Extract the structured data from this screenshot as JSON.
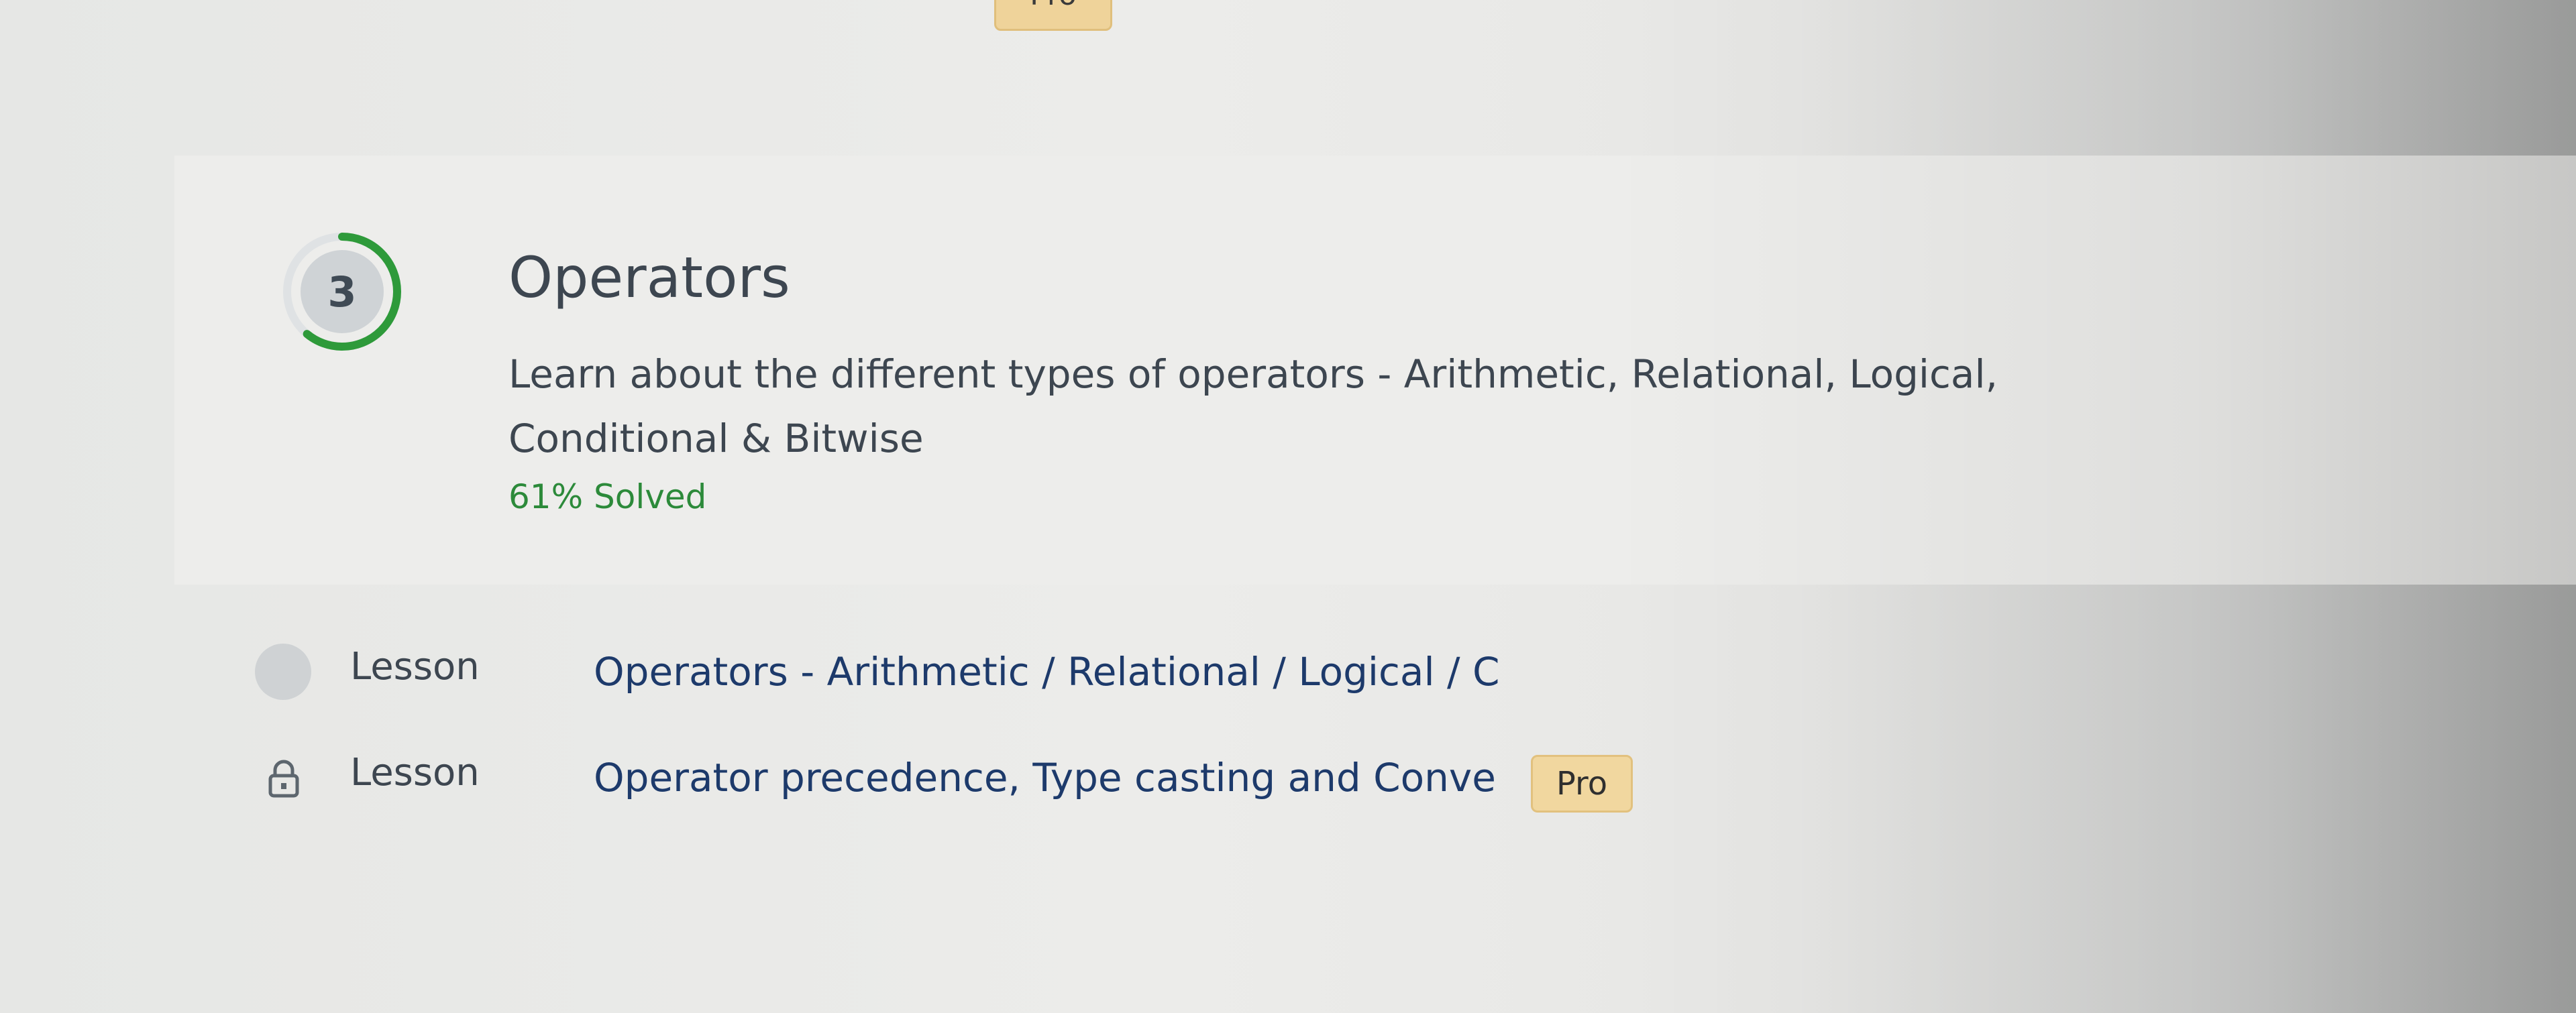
{
  "previous_module": {
    "badge_label": "Pro"
  },
  "module": {
    "number": "3",
    "title": "Operators",
    "description": "Learn about the different types of operators - Arithmetic, Relational, Logical, Conditional & Bitwise",
    "progress_label": "61% Solved",
    "progress_fraction": 0.61,
    "accent_color": "#2e9a3a"
  },
  "lessons": [
    {
      "type": "Lesson",
      "title": "Operators - Arithmetic / Relational / Logical / C",
      "status_icon": "incomplete-circle-icon",
      "locked": false,
      "badge": ""
    },
    {
      "type": "Lesson",
      "title": "Operator precedence, Type casting and Conve",
      "status_icon": "lock-icon",
      "locked": true,
      "badge": "Pro"
    }
  ]
}
